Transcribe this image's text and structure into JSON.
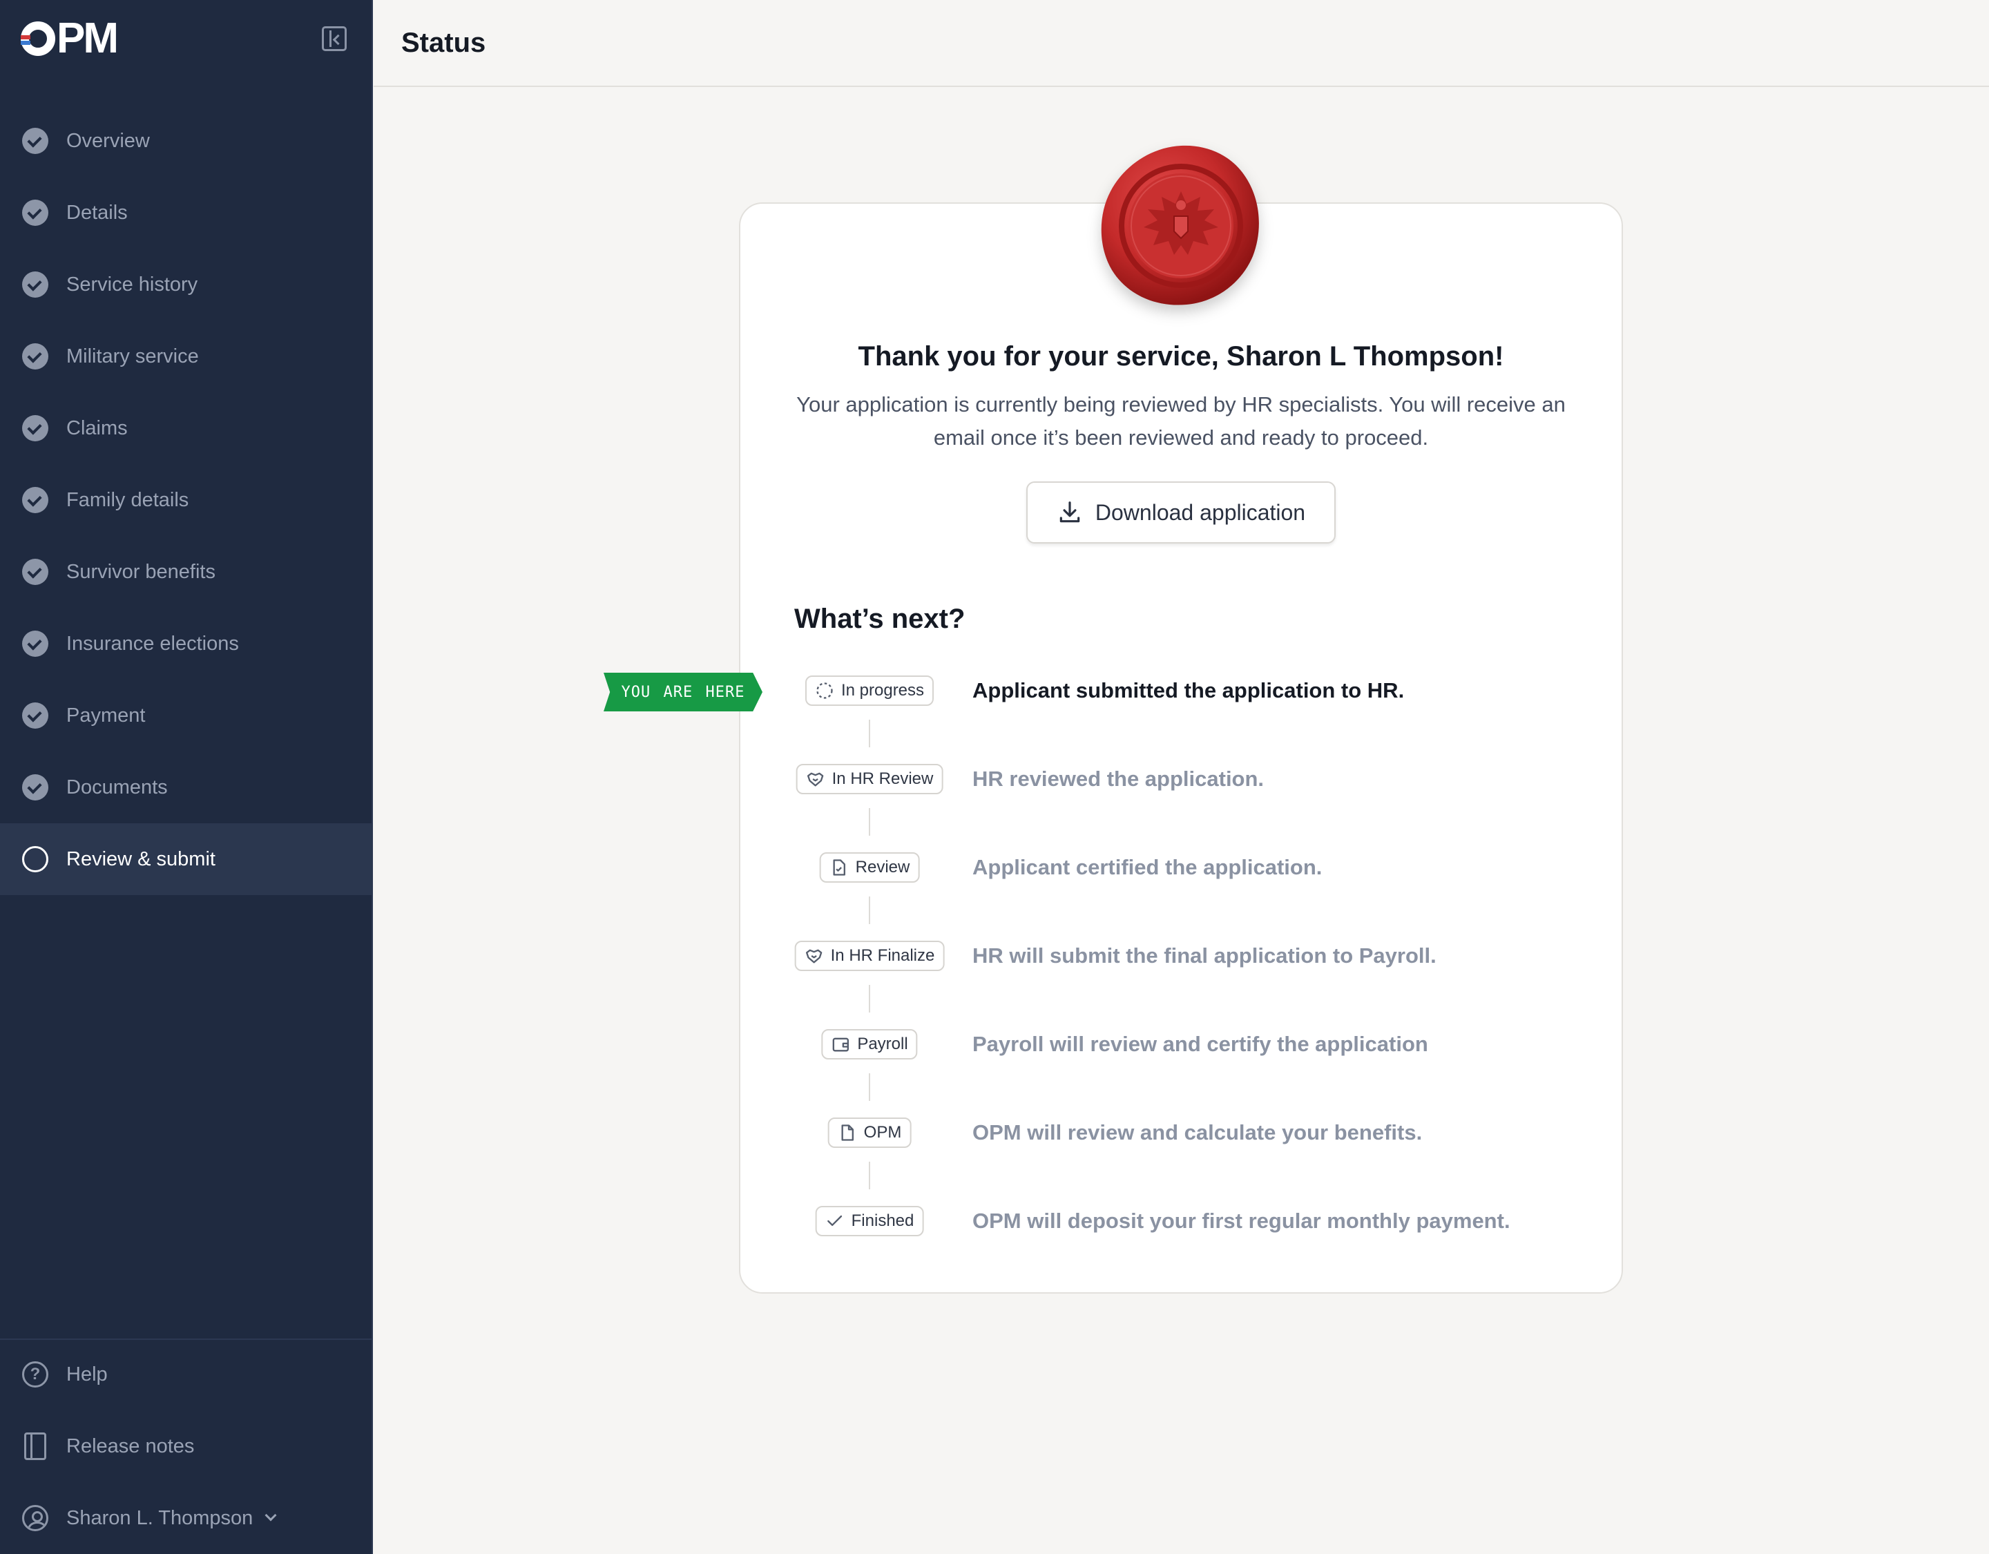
{
  "app": {
    "logo_text": "PM"
  },
  "sidebar": {
    "items": [
      {
        "label": "Overview",
        "state": "completed"
      },
      {
        "label": "Details",
        "state": "completed"
      },
      {
        "label": "Service history",
        "state": "completed"
      },
      {
        "label": "Military service",
        "state": "completed"
      },
      {
        "label": "Claims",
        "state": "completed"
      },
      {
        "label": "Family details",
        "state": "completed"
      },
      {
        "label": "Survivor benefits",
        "state": "completed"
      },
      {
        "label": "Insurance elections",
        "state": "completed"
      },
      {
        "label": "Payment",
        "state": "completed"
      },
      {
        "label": "Documents",
        "state": "completed"
      },
      {
        "label": "Review & submit",
        "state": "active"
      }
    ],
    "bottom": {
      "help": "Help",
      "release_notes": "Release notes",
      "user": "Sharon L. Thompson"
    }
  },
  "header": {
    "title": "Status"
  },
  "card": {
    "thanks": "Thank you for your service, Sharon L Thompson!",
    "subtitle": "Your application is currently being reviewed by HR specialists. You will receive an email once it’s been reviewed and ready to proceed.",
    "download_label": "Download application",
    "whats_next": "What’s next?",
    "you_are_here": "YOU ARE HERE",
    "steps": [
      {
        "status": "In progress",
        "icon": "dashed-circle-icon",
        "text": "Applicant submitted the application to HR.",
        "current": true
      },
      {
        "status": "In HR Review",
        "icon": "handshake-icon",
        "text": "HR reviewed the application.",
        "current": false
      },
      {
        "status": "Review",
        "icon": "file-check-icon",
        "text": "Applicant certified the application.",
        "current": false
      },
      {
        "status": "In HR Finalize",
        "icon": "handshake-icon",
        "text": "HR will submit the final application to Payroll.",
        "current": false
      },
      {
        "status": "Payroll",
        "icon": "wallet-icon",
        "text": "Payroll will review and certify the application",
        "current": false
      },
      {
        "status": "OPM",
        "icon": "file-icon",
        "text": "OPM will review and calculate your benefits.",
        "current": false
      },
      {
        "status": "Finished",
        "icon": "check-icon",
        "text": "OPM will deposit your first regular monthly payment.",
        "current": false
      }
    ]
  },
  "colors": {
    "sidebar_bg": "#1f2a40",
    "accent_green": "#179a45",
    "seal_red": "#c42a2a"
  }
}
